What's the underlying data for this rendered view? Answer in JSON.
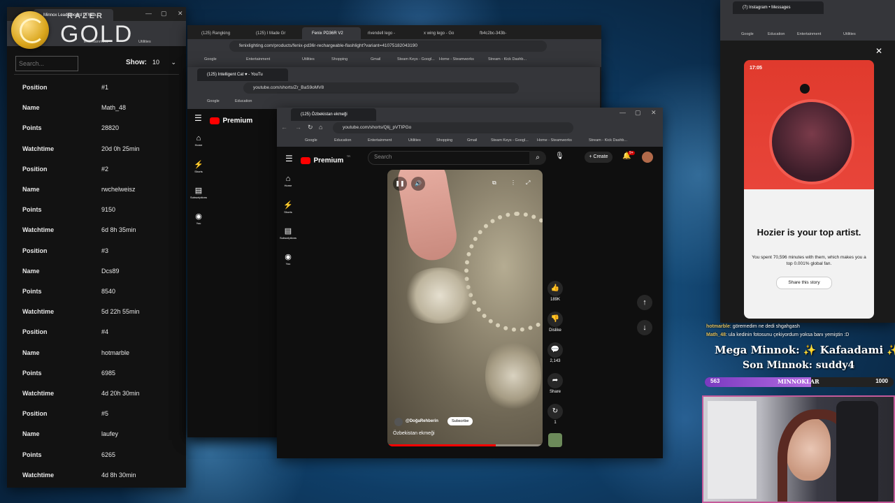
{
  "overlay": {
    "logo_brand": "RAZER",
    "logo_tier": "GOLD"
  },
  "leaderboard_window": {
    "title": "Minnox Leaderboard | The b...",
    "address": "...",
    "bookmarks": [
      "Steam Keys",
      "Entertainment",
      "Utilities"
    ],
    "search_placeholder": "Search...",
    "show_label": "Show:",
    "show_value": "10",
    "entries": [
      {
        "position_label": "Position",
        "position": "#1",
        "name_label": "Name",
        "name": "Math_48",
        "points_label": "Points",
        "points": "28820",
        "watch_label": "Watchtime",
        "watchtime": "20d 0h 25min"
      },
      {
        "position_label": "Position",
        "position": "#2",
        "name_label": "Name",
        "name": "rwchelweisz",
        "points_label": "Points",
        "points": "9150",
        "watch_label": "Watchtime",
        "watchtime": "6d 8h 35min"
      },
      {
        "position_label": "Position",
        "position": "#3",
        "name_label": "Name",
        "name": "Dcs89",
        "points_label": "Points",
        "points": "8540",
        "watch_label": "Watchtime",
        "watchtime": "5d 22h 55min"
      },
      {
        "position_label": "Position",
        "position": "#4",
        "name_label": "Name",
        "name": "hotmarble",
        "points_label": "Points",
        "points": "6985",
        "watch_label": "Watchtime",
        "watchtime": "4d 20h 30min"
      },
      {
        "position_label": "Position",
        "position": "#5",
        "name_label": "Name",
        "name": "laufey",
        "points_label": "Points",
        "points": "6265",
        "watch_label": "Watchtime",
        "watchtime": "4d 8h 30min"
      }
    ]
  },
  "fenix_window": {
    "tabs": [
      "(125) Rangking",
      "(125) I Made Gr",
      "Fenix PD36R V2",
      "rivendell lego -",
      "x wing lego - Go",
      "fb4c2bc-343b-"
    ],
    "address": "fenixlighting.com/products/fenix-pd36r-rechargeable-flashlight?variant=41075182043190",
    "bookmarks": [
      "Google",
      "Education",
      "Entertainment",
      "Utilities",
      "Shopping",
      "Gmail",
      "Steam Keys - Googl...",
      "Home - Steamworks",
      "Stream - Kick Dashb..."
    ]
  },
  "cat_window": {
    "tab": "(125) Intelligent Cat ♥ - YouTu",
    "address": "youtube.com/shorts/Zr_BaS9oMV8",
    "bookmarks": [
      "Google",
      "Education",
      "Entertainment",
      "Utilities",
      "Shopping",
      "Gmail",
      "Steam Keys - Googl...",
      "Home - Steamworks",
      "Stream - Kick Dashb..."
    ],
    "brand": "Premium",
    "brand_suffix": "TR",
    "sidebar": [
      "Home",
      "Shorts",
      "Subscriptions",
      "You"
    ]
  },
  "yt_window": {
    "tab": "(125) Özbekistan ekmeği",
    "address": "youtube.com/shorts/Qlij_pVTIPGo",
    "bookmarks": [
      "Google",
      "Education",
      "Entertainment",
      "Utilities",
      "Shopping",
      "Gmail",
      "Steam Keys - Googl...",
      "Home - Steamworks",
      "Stream - Kick Dashb..."
    ],
    "brand": "Premium",
    "brand_suffix": "TR",
    "search_placeholder": "Search",
    "create_label": "Create",
    "notif_badge": "9+",
    "sidebar": [
      "Home",
      "Shorts",
      "Subscriptions",
      "You"
    ],
    "actions": {
      "likes": "189K",
      "dislike": "Dislike",
      "comments": "2,143",
      "share": "Share",
      "remix": "1"
    },
    "channel": "@DoğaRehberin",
    "subscribe": "Subscribe",
    "video_title": "Özbekistan ekmeği",
    "progress": 0.7
  },
  "instagram_window": {
    "tab": "(7) Instagram • Messages",
    "bookmarks": [
      "Google",
      "Education",
      "Entertainment",
      "Utilities"
    ],
    "time": "17:05",
    "headline": "Hozier is your top artist.",
    "body": "You spent 70,596 minutes with them, which makes you a top 0.001% global fan.",
    "share_label": "Share this story"
  },
  "chat": {
    "messages": [
      {
        "user": "hotmarble",
        "text": "göremedim ne dedi shgahgash"
      },
      {
        "user": "Math_48",
        "text": "ula kedinin fotosunu çekiyordum yoksa banı yemiştin :D"
      }
    ],
    "mega_line": "Mega Minnok: ✨ Kafaadami ✨",
    "son_line": "Son Minnok: suddy4",
    "bar_left": "563",
    "bar_label": "MINNOKLAR",
    "bar_right": "1000",
    "bar_fill": 0.563
  }
}
